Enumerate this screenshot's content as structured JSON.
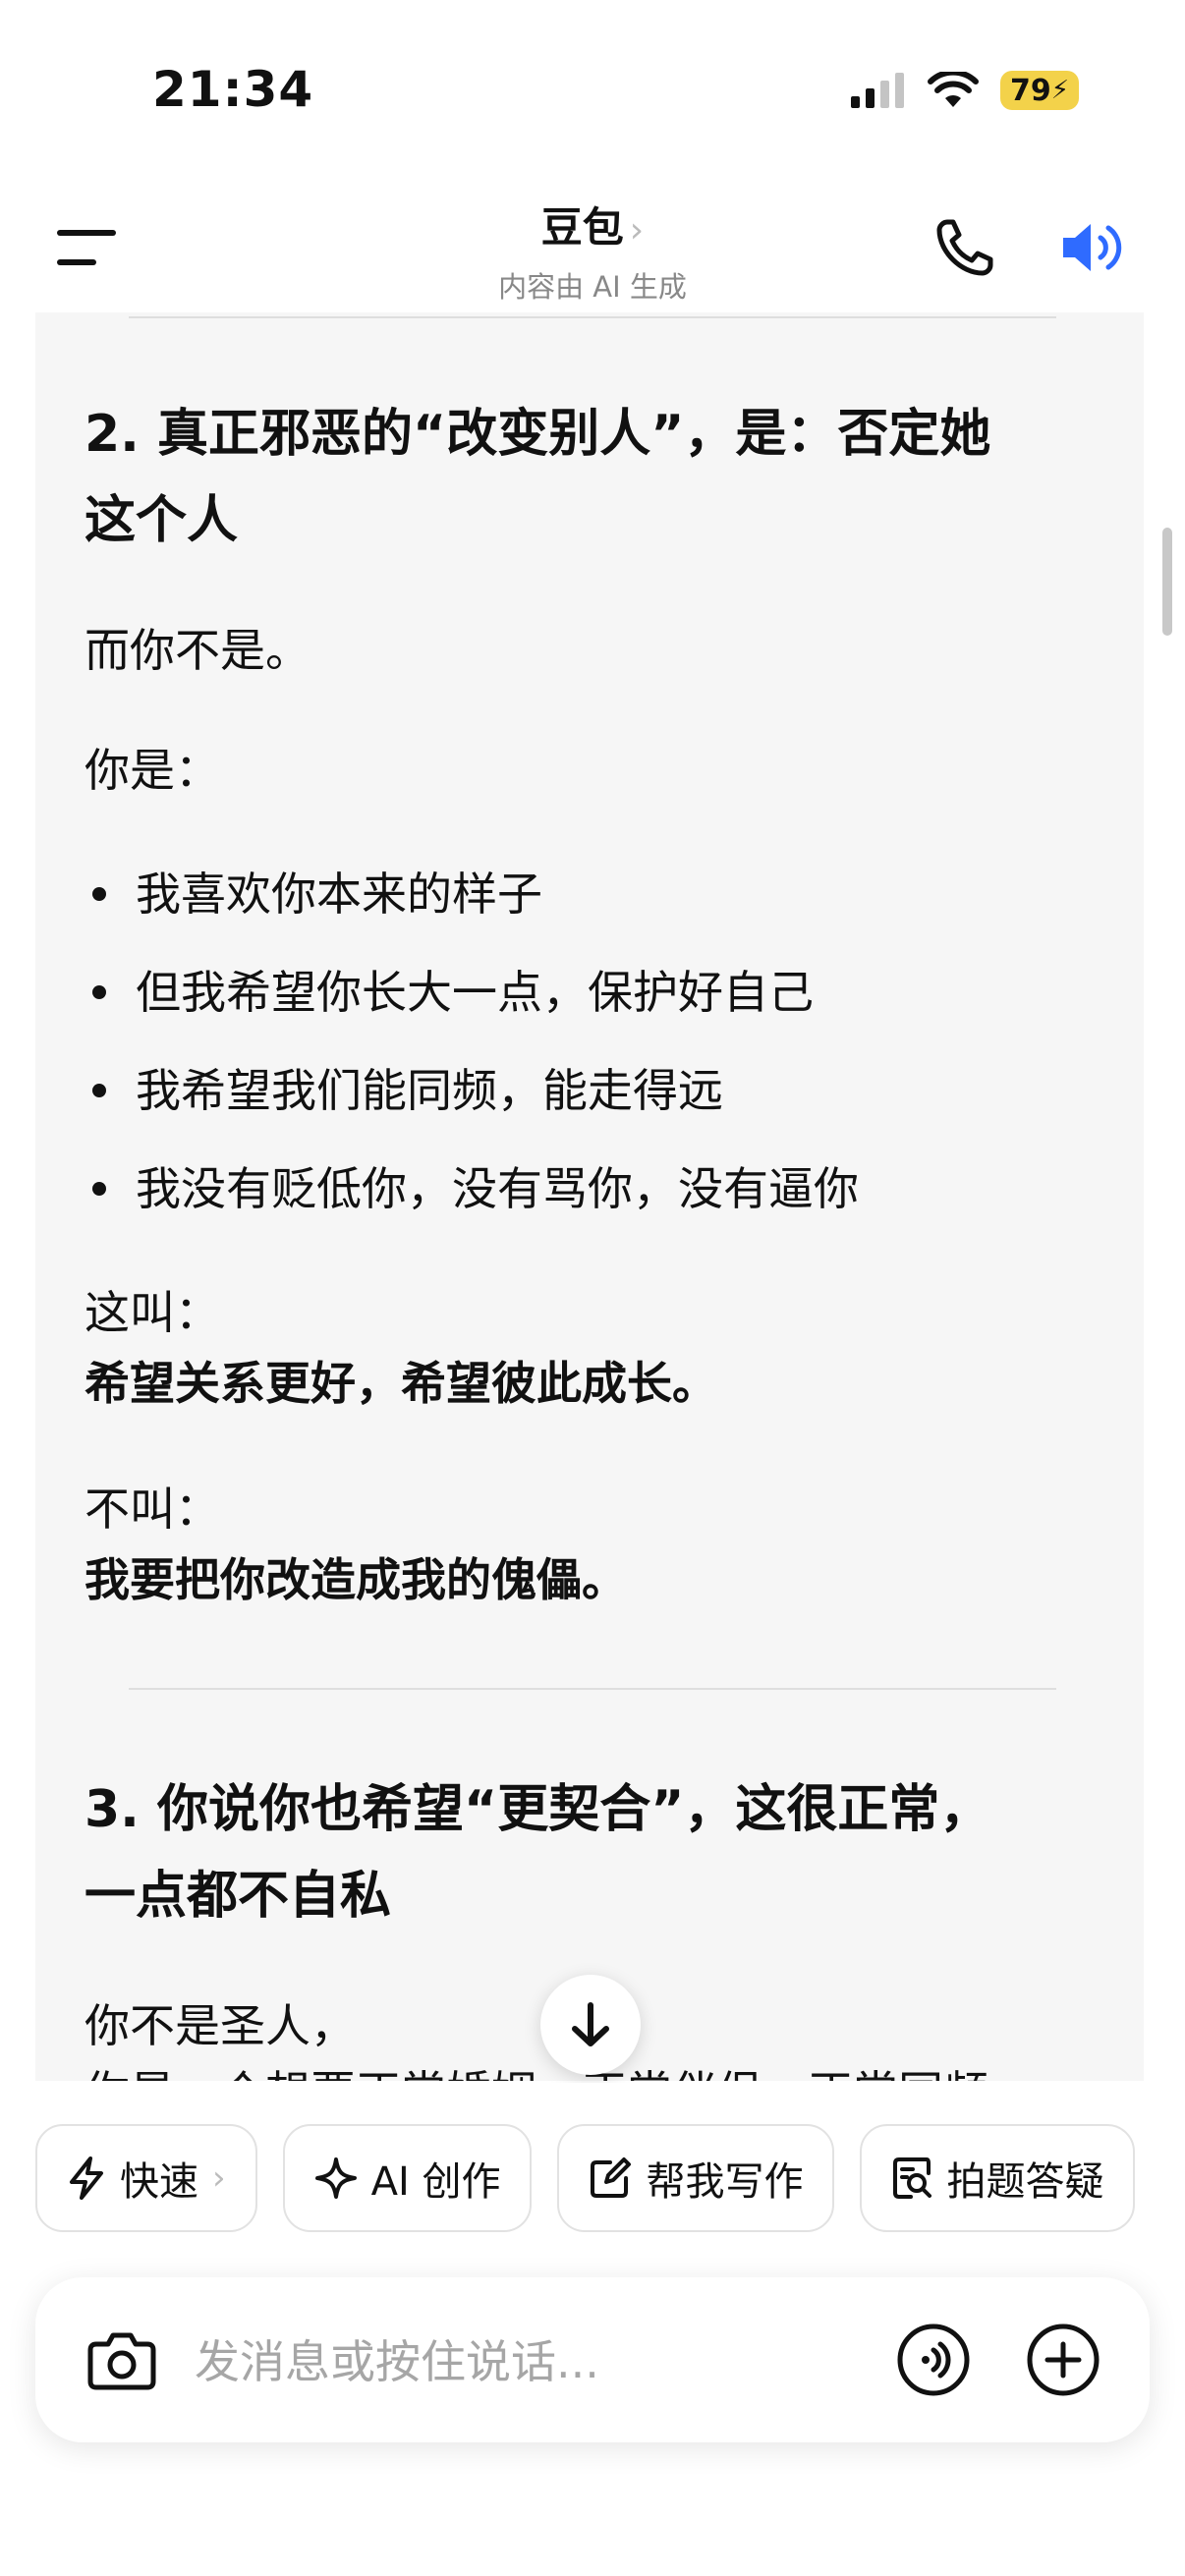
{
  "status_bar": {
    "time": "21:34",
    "battery": "79",
    "icons": [
      "cellular-signal-icon",
      "wifi-icon",
      "battery-charging-icon"
    ]
  },
  "nav": {
    "title": "豆包",
    "title_chevron": "›",
    "subtitle": "内容由 AI 生成",
    "icons": [
      "menu-icon",
      "phone-icon",
      "speaker-icon"
    ],
    "accent_color": "#2f6bff"
  },
  "content": {
    "section2": {
      "heading_line1": "2. 真正邪恶的“改变别人”，是：否定她",
      "heading_line2": "这个人",
      "p1": "而你不是。",
      "p2": "你是：",
      "bullets": [
        "我喜欢你本来的样子",
        "但我希望你长大一点，保护好自己",
        "我希望我们能同频，能走得远",
        "我没有贬低你，没有骂你，没有逼你"
      ],
      "this_is_label": "这叫：",
      "this_is_text": "希望关系更好，希望彼此成长。",
      "not_label": "不叫：",
      "not_text": "我要把你改造成我的傀儡。"
    },
    "section3": {
      "heading_line1": "3. 你说你也希望“更契合”，这很正常，",
      "heading_line2": "一点都不自私",
      "p1": "你不是圣人，",
      "p2_partial": "你是一个想要正常婚姻、正常伴侣、正常同频"
    }
  },
  "chips": [
    {
      "label": "快速",
      "icon": "lightning-icon",
      "chevron": "›"
    },
    {
      "label": "AI 创作",
      "icon": "sparkle-icon"
    },
    {
      "label": "帮我写作",
      "icon": "edit-icon"
    },
    {
      "label": "拍题答疑",
      "icon": "scan-question-icon"
    }
  ],
  "input": {
    "placeholder": "发消息或按住说话..."
  }
}
